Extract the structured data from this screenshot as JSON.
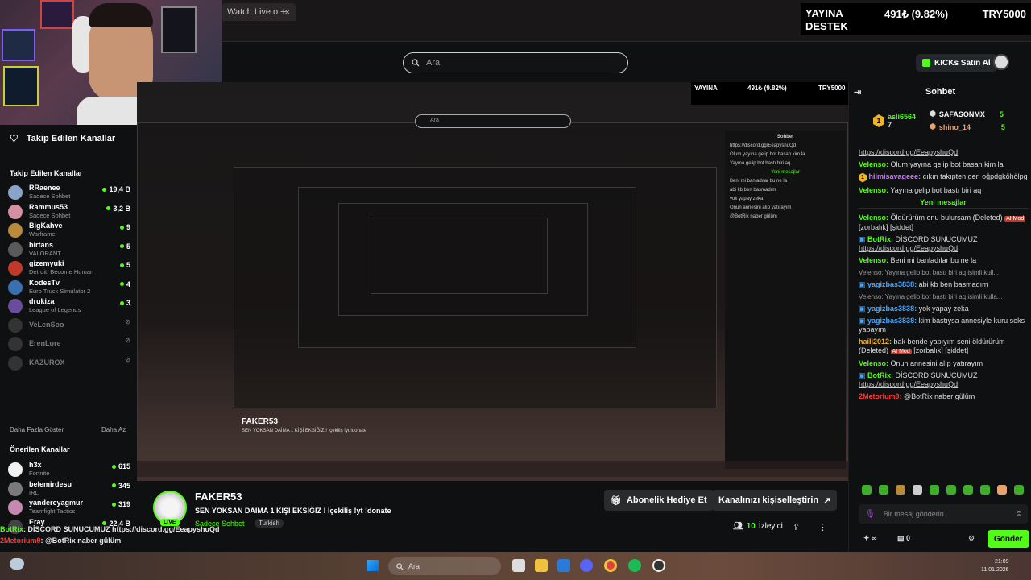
{
  "browser": {
    "tab_title": "Watch Live o",
    "close": "×",
    "new_tab": "+"
  },
  "donation": {
    "line1": "YAYINA",
    "line2": "DESTEK",
    "amount": "491₺ (9.82%)",
    "goal": "TRY5000"
  },
  "header": {
    "search_placeholder": "Ara",
    "kicks_label": "KICKs Satın Al"
  },
  "sidebar": {
    "top_title": "Takip Edilen Kanallar",
    "followed_title": "Takip Edilen Kanallar",
    "followed": [
      {
        "name": "RRaenee",
        "game": "Sadece Sohbet",
        "viewers": "19,4 B",
        "color": "#8aa4c8"
      },
      {
        "name": "Rammus53",
        "game": "Sadece Sohbet",
        "viewers": "3,2 B",
        "color": "#d48fa0"
      },
      {
        "name": "BigKahve",
        "game": "Warframe",
        "viewers": "9",
        "color": "#b98a3c"
      },
      {
        "name": "birtans",
        "game": "VALORANT",
        "viewers": "5",
        "color": "#5a5a5a"
      },
      {
        "name": "gizemyuki",
        "game": "Detroit: Become Human",
        "viewers": "5",
        "color": "#c0392b"
      },
      {
        "name": "KodesTv",
        "game": "Euro Truck Simulator 2",
        "viewers": "4",
        "color": "#3a6fb0"
      },
      {
        "name": "drukiza",
        "game": "League of Legends",
        "viewers": "3",
        "color": "#6a4c9c"
      }
    ],
    "offline": [
      {
        "name": "VeLenSoo",
        "icon": "off"
      },
      {
        "name": "ErenLore",
        "icon": "off"
      },
      {
        "name": "KAZUROX",
        "icon": "off"
      }
    ],
    "show_more": "Daha Fazla Göster",
    "show_less": "Daha Az",
    "recommended_title": "Önerilen Kanallar",
    "recommended": [
      {
        "name": "h3x",
        "game": "Fortnite",
        "viewers": "615",
        "color": "#f2f2f2"
      },
      {
        "name": "belemirdesu",
        "game": "IRL",
        "viewers": "345",
        "color": "#7a7a7a"
      },
      {
        "name": "yandereyagmur",
        "game": "Teamfight Tactics",
        "viewers": "319",
        "color": "#c58ab0"
      },
      {
        "name": "Eray",
        "game": "",
        "viewers": "22,4 B",
        "color": "#444"
      }
    ]
  },
  "stream": {
    "streamer": "FAKER53",
    "title": "SEN YOKSAN DAİMA 1 KİŞİ EKSİĞİZ ! İçekiliş !yt !donate",
    "category": "Sadece Sohbet",
    "language": "Turkish",
    "live": "LIVE",
    "subscribe_gift": "Abonelik Hediye Et",
    "customize": "Kanalınızı kişiselleştirin",
    "viewers_count": "10",
    "viewers_label": "İzleyici"
  },
  "overlay_chat": [
    {
      "user": "BotRix",
      "text": ": DİSCORD SUNUCUMUZ https://discord.gg/EeapyshuQd"
    },
    {
      "user": "2Metorium9",
      "text": ": @BotRix naber gülüm"
    }
  ],
  "chat": {
    "title": "Sohbet",
    "pinned": {
      "rank1_user": "asli6564",
      "rank1_num": "1",
      "rank1_count": "7",
      "top2_user": "SAFASONMX",
      "top2_count": "5",
      "top3_user": "shino_14",
      "top3_count": "5"
    },
    "link_top": "https://discord.gg/EeapyshuQd",
    "msg1_user": "Velenso:",
    "msg1_text": "Olum yayına gelip bot basan kim la",
    "msg2_user": "hilmisavageee:",
    "msg2_text": "cıkın takıpten geri oğpdgköhölpg",
    "msg3_user": "Velenso:",
    "msg3_text": "Yayına gelip bot bastı biri aq",
    "new_messages": "Yeni mesajlar",
    "msg4_user": "Velenso:",
    "msg4_text": "Öldürürüm onu bulursam",
    "msg4_deleted": "(Deleted)",
    "msg4_mod": "AI Mod",
    "msg4_tags": "[zorbalık] [şiddet]",
    "msg5_user": "BotRix:",
    "msg5_text": "DİSCORD SUNUCUMUZ",
    "msg5_link": "https://discord.gg/EeapyshuQd",
    "msg6_user": "Velenso:",
    "msg6_text": "Beni mi banladılar bu ne la",
    "reply1": "Velenso: Yayına gelip bot bastı biri aq isimli kull...",
    "msg7_user": "yagizbas3838:",
    "msg7_text": "abi kb ben basmadım",
    "reply2": "Velenso: Yayına gelip bot bastı biri aq isimli kulla...",
    "msg8_user": "yagizbas3838:",
    "msg8_text": "yok yapay zeka",
    "msg9_user": "yagizbas3838:",
    "msg9_text": "kim bastıysa annesiyle kuru seks yapayım",
    "msg10_user": "haili2012:",
    "msg10_text": "bak bende yapıyım seni öldürürüm",
    "msg10_deleted": "(Deleted)",
    "msg10_mod": "AI Mod",
    "msg10_tags": "[zorbalık] [şiddet]",
    "msg11_user": "Velenso:",
    "msg11_text": "Onun annesini alıp yatırayım",
    "msg12_user": "BotRix:",
    "msg12_text": "DİSCORD SUNUCUMUZ",
    "msg12_link": "https://discord.gg/EeapyshuQd",
    "msg13_user": "2Metorium9:",
    "msg13_text": "@BotRix naber gülüm",
    "input_placeholder": "Bir mesaj gönderin",
    "points": "∞",
    "boxes": "0",
    "send": "Gönder"
  },
  "taskbar": {
    "search": "Ara",
    "time": "21:09",
    "date": "11.01.2026"
  }
}
